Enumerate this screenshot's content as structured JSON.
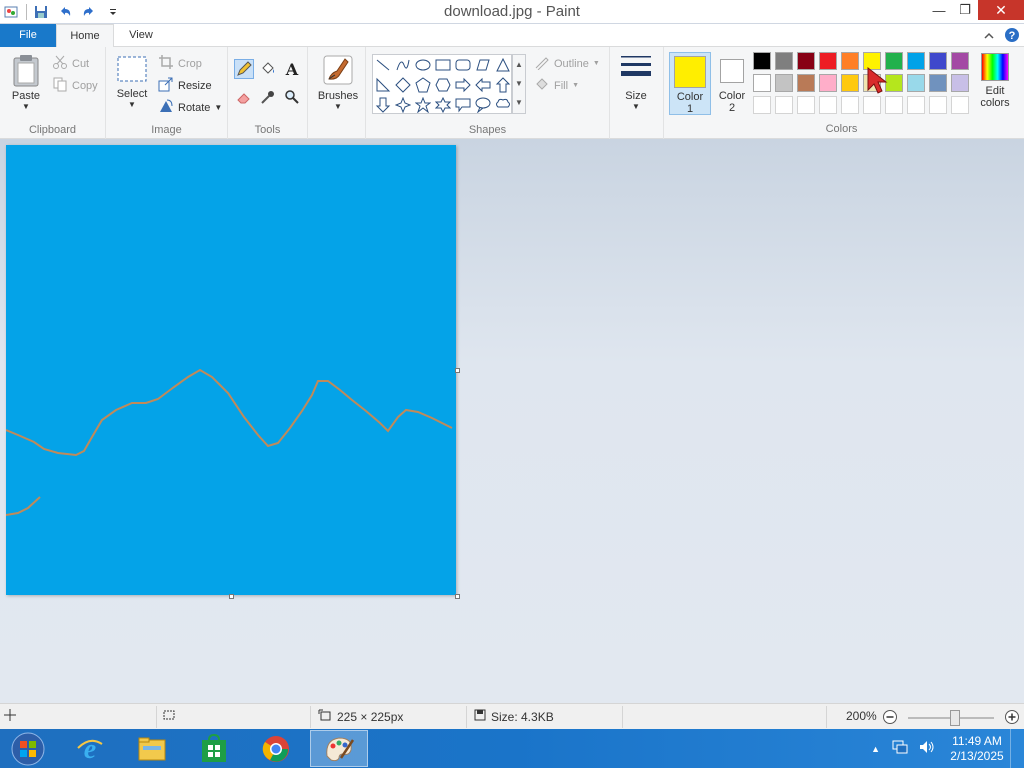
{
  "window": {
    "title": "download.jpg - Paint"
  },
  "tabs": {
    "file": "File",
    "home": "Home",
    "view": "View"
  },
  "clipboard": {
    "paste": "Paste",
    "cut": "Cut",
    "copy": "Copy",
    "label": "Clipboard"
  },
  "image": {
    "select": "Select",
    "crop": "Crop",
    "resize": "Resize",
    "rotate": "Rotate",
    "label": "Image"
  },
  "tools": {
    "label": "Tools"
  },
  "brushes": {
    "label": "Brushes"
  },
  "shapes": {
    "outline": "Outline",
    "fill": "Fill",
    "label": "Shapes"
  },
  "size": {
    "label": "Size"
  },
  "colors": {
    "color1_label": "Color",
    "color1_num": "1",
    "color2_label": "Color",
    "color2_num": "2",
    "edit_label": "Edit",
    "edit_label2": "colors",
    "label": "Colors",
    "color1": "#ffee00",
    "color2": "#ffffff",
    "row1": [
      "#000000",
      "#7f7f7f",
      "#880015",
      "#ed1c24",
      "#ff7f27",
      "#fff200",
      "#22b14c",
      "#00a2e8",
      "#3f48cc",
      "#a349a4"
    ],
    "row2": [
      "#ffffff",
      "#c3c3c3",
      "#b97a57",
      "#ffaec9",
      "#ffc90e",
      "#efe4b0",
      "#b5e61d",
      "#99d9ea",
      "#7092be",
      "#c8bfe7"
    ]
  },
  "canvas": {
    "background": "#04a3e8",
    "line_color": "#c08a5a"
  },
  "status": {
    "dimensions": "225 × 225px",
    "size": "Size: 4.3KB",
    "zoom": "200%"
  },
  "taskbar": {
    "time": "11:49 AM",
    "date": "2/13/2025"
  }
}
